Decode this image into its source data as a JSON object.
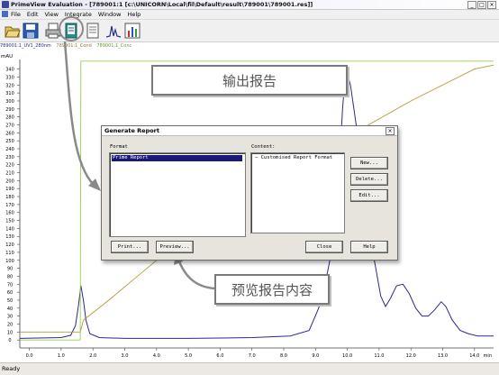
{
  "window": {
    "title": "PrimeView Evaluation - [789001:1    [c:\\UNICORN\\Local\\fil\\Default\\result\\789001\\789001.res]]",
    "controls": [
      "_",
      "□",
      "×"
    ]
  },
  "menu": [
    "File",
    "Edit",
    "View",
    "Integrate",
    "Window",
    "Help"
  ],
  "toolbar": {
    "buttons": [
      "open-folder-icon",
      "save-disk-icon",
      "print-icon",
      "report-book-icon",
      "document-icon",
      "peak-icon",
      "chart-bars-icon"
    ]
  },
  "traces": [
    "789001:1_UV1_280nm",
    "789001:1_Cond",
    "789001:1_Conc"
  ],
  "chart_data": {
    "type": "line",
    "ylabel": "mAU",
    "xlabel": "min",
    "y_ticks": [
      "0",
      "10",
      "20",
      "30",
      "40",
      "50",
      "60",
      "70",
      "80",
      "90",
      "100",
      "110",
      "120",
      "130",
      "140",
      "150",
      "160",
      "170",
      "180",
      "190",
      "200",
      "210",
      "220",
      "230",
      "240",
      "250",
      "260",
      "270",
      "280",
      "290",
      "300",
      "310",
      "320",
      "330",
      "340"
    ],
    "x_ticks": [
      "0.0",
      "1.0",
      "2.0",
      "3.0",
      "4.0",
      "5.0",
      "6.0",
      "7.0",
      "8.0",
      "9.0",
      "10.0",
      "11.0",
      "12.0",
      "13.0",
      "14.0"
    ],
    "xlim": [
      -0.3,
      14.6
    ],
    "ylim": [
      -10,
      352
    ],
    "series": [
      {
        "name": "789001:1_UV1_280nm",
        "color": "#2a2a8c",
        "x": [
          -0.3,
          1.0,
          1.3,
          1.45,
          1.55,
          1.62,
          1.7,
          1.78,
          1.9,
          2.2,
          3.0,
          5.0,
          7.0,
          8.2,
          8.8,
          9.1,
          9.3,
          9.5,
          9.7,
          9.85,
          9.95,
          10.1,
          10.35,
          10.6,
          10.85,
          11.05,
          11.2,
          11.35,
          11.55,
          11.75,
          11.95,
          12.15,
          12.35,
          12.55,
          12.75,
          12.95,
          13.1,
          13.3,
          13.55,
          13.8,
          14.1,
          14.6
        ],
        "y": [
          2,
          3,
          6,
          18,
          45,
          68,
          50,
          25,
          8,
          3,
          2,
          2,
          3,
          5,
          12,
          40,
          70,
          110,
          180,
          290,
          340,
          320,
          250,
          140,
          100,
          55,
          42,
          52,
          68,
          70,
          58,
          40,
          30,
          30,
          38,
          48,
          42,
          25,
          12,
          8,
          5,
          5
        ]
      },
      {
        "name": "789001:1_Cond",
        "color": "#b29b3a",
        "x": [
          -0.3,
          1.6,
          1.7,
          2.5,
          4.0,
          6.0,
          8.0,
          10.0,
          12.0,
          14.0,
          14.6
        ],
        "y": [
          10,
          10,
          25,
          50,
          100,
          155,
          205,
          255,
          300,
          340,
          345
        ]
      },
      {
        "name": "789001:1_Conc",
        "color": "#9acd52",
        "x": [
          -0.3,
          1.6,
          1.62,
          3.0,
          5.0,
          7.0,
          9.0,
          10.0,
          11.0,
          13.0,
          14.6
        ],
        "y": [
          0,
          0,
          350,
          350,
          350,
          350,
          350,
          350,
          350,
          350,
          350
        ]
      }
    ]
  },
  "callout_top": "输出报告",
  "callout_bottom": "预览报告内容",
  "dialog": {
    "title": "Generate Report",
    "close": "×",
    "format_label": "Format",
    "format_items": [
      "Prime Report"
    ],
    "content_label": "Content:",
    "content_items": [
      "Customised Report Format"
    ],
    "buttons": {
      "new": "New...",
      "delete": "Delete...",
      "edit": "Edit...",
      "print": "Print...",
      "preview": "Preview...",
      "close": "Close",
      "help": "Help"
    }
  },
  "status": "Ready",
  "colors": {
    "window_bg": "#f0f0f0",
    "dialog_bg": "#e7e4dd",
    "selection": "#1a1a7a",
    "annotation_gray": "#7a7a7a"
  }
}
